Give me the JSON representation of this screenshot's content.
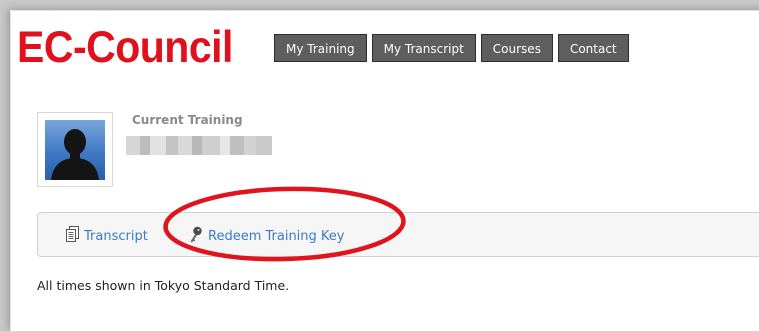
{
  "brand": {
    "logo_text": "EC-Council",
    "logo_color": "#e0111d"
  },
  "nav": {
    "items": [
      {
        "label": "My Training"
      },
      {
        "label": "My Transcript"
      },
      {
        "label": "Courses"
      },
      {
        "label": "Contact"
      }
    ],
    "button_bg": "#5e5e5e"
  },
  "profile": {
    "current_training_label": "Current Training",
    "avatar_icon": "person-silhouette-icon"
  },
  "actions": {
    "transcript_label": "Transcript",
    "transcript_icon": "document-icon",
    "redeem_label": "Redeem Training Key",
    "redeem_icon": "key-icon",
    "link_color": "#3a7bc8"
  },
  "footer": {
    "timezone_note": "All times shown in Tokyo Standard Time."
  },
  "annotation": {
    "ellipse_color": "#e0141c"
  }
}
